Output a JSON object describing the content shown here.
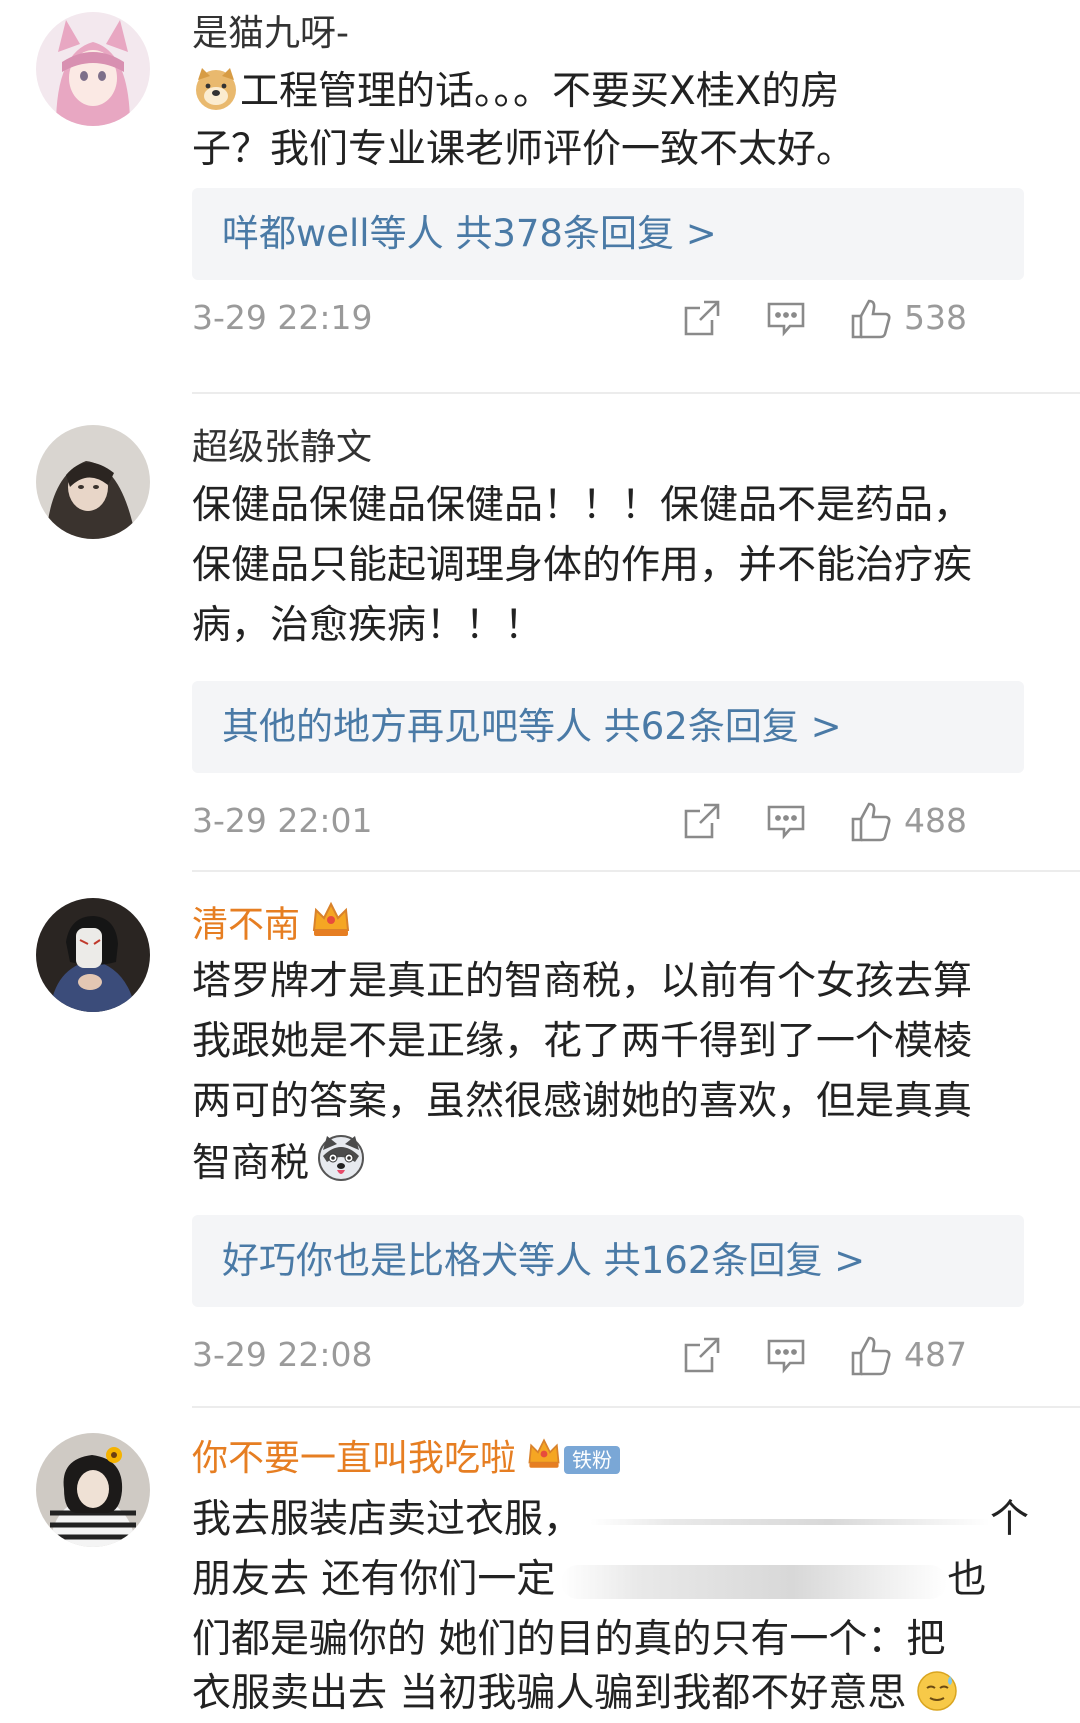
{
  "comments": [
    {
      "username": "是猫九呀-",
      "lines": [
        "工程管理的话。。。不要买X桂X的房",
        "子？我们专业课老师评价一致不太好。"
      ],
      "reply_summary": "咩都well等人  共378条回复 >",
      "timestamp": "3-29 22:19",
      "likes": "538",
      "avatar_icon": "anime-girl-avatar",
      "emoji_icon": "doge-emoji"
    },
    {
      "username": "超级张静文",
      "lines": [
        "保健品保健品保健品！！！保健品不是药品，",
        "保健品只能起调理身体的作用，并不能治疗疾",
        "病，治愈疾病！！！"
      ],
      "reply_summary": "其他的地方再见吧等人  共62条回复 >",
      "timestamp": "3-29 22:01",
      "likes": "488",
      "avatar_icon": "portrait-avatar"
    },
    {
      "username": "清不南",
      "lines": [
        "塔罗牌才是真正的智商税，以前有个女孩去算",
        "我跟她是不是正缘，花了两千得到了一个模棱",
        "两可的答案，虽然很感谢她的喜欢，但是真真",
        "智商税"
      ],
      "reply_summary": "好巧你也是比格犬等人  共162条回复 >",
      "timestamp": "3-29 22:08",
      "likes": "487",
      "avatar_icon": "masked-person-avatar",
      "emoji_icon": "husky-emoji",
      "badge_icon": "vip-crown-icon"
    },
    {
      "username": "你不要一直叫我吃啦",
      "badge_label": "铁粉",
      "lines": [
        "我去服装店卖过衣服，",
        "个",
        "朋友去 还有你们一定",
        "也",
        "们都是骗你的 她们的目的真的只有一个：把",
        "衣服卖出去 当初我骗人骗到我都不好意思"
      ],
      "avatar_icon": "sunflower-girl-avatar",
      "emoji_icon": "sweat-emoji",
      "badge_icon": "vip-crown-icon"
    }
  ],
  "icons": {
    "share": "share-icon",
    "comment": "comment-icon",
    "like": "like-icon"
  },
  "colors": {
    "vip_name": "#e67e22",
    "reply_link": "#4a7aa6",
    "meta": "#9a9a9a",
    "badge_bg": "#7aa7d6"
  }
}
